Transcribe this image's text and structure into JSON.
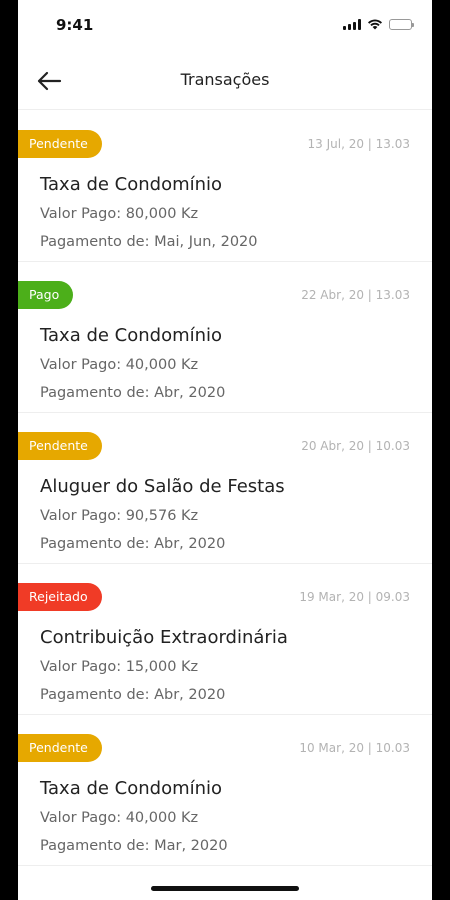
{
  "status_bar": {
    "time": "9:41"
  },
  "header": {
    "title": "Transações"
  },
  "colors": {
    "pendente": "#E6A800",
    "pago": "#4CAF1A",
    "rejeitado": "#F03B26"
  },
  "transactions": [
    {
      "status": "Pendente",
      "status_key": "pendente",
      "date": "13 Jul, 20 | 13.03",
      "title": "Taxa de Condomínio",
      "amount": "Valor Pago: 80,000 Kz",
      "period": "Pagamento de: Mai, Jun, 2020"
    },
    {
      "status": "Pago",
      "status_key": "pago",
      "date": "22 Abr, 20 | 13.03",
      "title": "Taxa de Condomínio",
      "amount": "Valor Pago: 40,000 Kz",
      "period": "Pagamento de: Abr, 2020"
    },
    {
      "status": "Pendente",
      "status_key": "pendente",
      "date": "20 Abr, 20 | 10.03",
      "title": "Aluguer do Salão de Festas",
      "amount": "Valor Pago: 90,576 Kz",
      "period": "Pagamento de: Abr, 2020"
    },
    {
      "status": "Rejeitado",
      "status_key": "rejeitado",
      "date": "19 Mar, 20 | 09.03",
      "title": "Contribuição Extraordinária",
      "amount": "Valor Pago: 15,000 Kz",
      "period": "Pagamento de: Abr, 2020"
    },
    {
      "status": "Pendente",
      "status_key": "pendente",
      "date": "10 Mar, 20 | 10.03",
      "title": "Taxa de Condomínio",
      "amount": "Valor Pago: 40,000 Kz",
      "period": "Pagamento de: Mar, 2020"
    }
  ]
}
